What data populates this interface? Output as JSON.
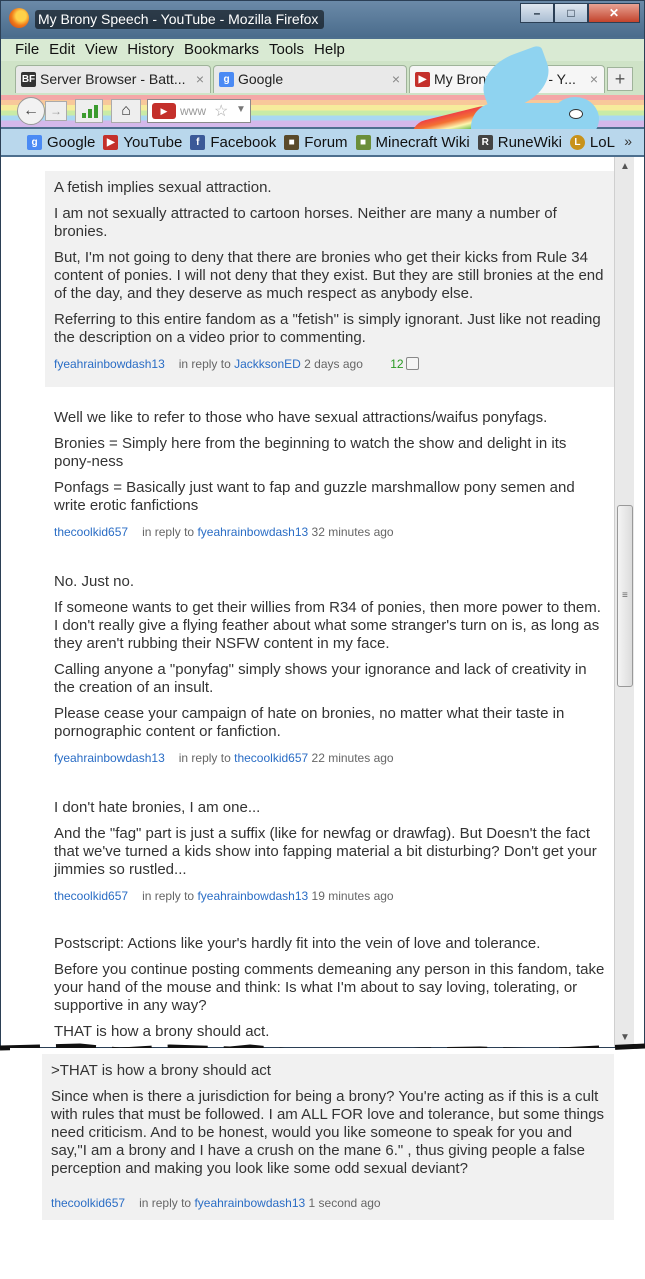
{
  "window": {
    "title": "My Brony Speech - YouTube - Mozilla Firefox",
    "controls": [
      "–",
      "□",
      "✕"
    ]
  },
  "menu": [
    "File",
    "Edit",
    "View",
    "History",
    "Bookmarks",
    "Tools",
    "Help"
  ],
  "tabs": [
    {
      "label": "Server Browser - Batt...",
      "icon": "bf-icon",
      "close": "×"
    },
    {
      "label": "Google",
      "icon": "google-icon",
      "close": "×"
    },
    {
      "label": "My Brony Speech - Y...",
      "icon": "youtube-icon",
      "close": "×"
    }
  ],
  "new_tab": "+",
  "nav": {
    "url_text": "www",
    "back": "←",
    "forward": "→"
  },
  "bookmarks": [
    {
      "label": "Google",
      "icon": "google-icon",
      "color": "#4a8af4"
    },
    {
      "label": "YouTube",
      "icon": "youtube-icon",
      "color": "#c4302b"
    },
    {
      "label": "Facebook",
      "icon": "facebook-icon",
      "color": "#3b5998"
    },
    {
      "label": "Forum",
      "icon": "forum-icon",
      "color": "#5a4a2a"
    },
    {
      "label": "Minecraft Wiki",
      "icon": "minecraft-icon",
      "color": "#6b8e3a"
    },
    {
      "label": "RuneWiki",
      "icon": "runewiki-icon",
      "color": "#444444"
    },
    {
      "label": "LoL",
      "icon": "lol-icon",
      "color": "#c8921a"
    }
  ],
  "bookmarks_more": "»",
  "comments": [
    {
      "paragraphs": [
        "A fetish implies sexual attraction.",
        "I am not sexually attracted to cartoon horses. Neither are many a number of bronies.",
        "But, I'm not going to deny that there are bronies who get their kicks from Rule 34 content of ponies. I will not deny that they exist. But they are still bronies at the end of the day, and they deserve as much respect as anybody else.",
        "Referring to this entire fandom as a \"fetish\" is simply ignorant. Just like not reading the description on a video prior to commenting."
      ],
      "user": "fyeahrainbowdash13",
      "in_reply_to": "in reply to",
      "reply_user": "JackksonED",
      "time": "2 days ago",
      "likes": "12"
    },
    {
      "paragraphs": [
        "Well we like to refer to those who have sexual attractions/waifus ponyfags.",
        "Bronies = Simply here from the beginning to watch the show and delight in its pony-ness",
        "Ponfags = Basically just want to fap and guzzle marshmallow pony semen and write erotic fanfictions"
      ],
      "user": "thecoolkid657",
      "in_reply_to": "in reply to",
      "reply_user": "fyeahrainbowdash13",
      "time": "32 minutes ago"
    },
    {
      "paragraphs": [
        "No. Just no.",
        "If someone wants to get their willies from R34 of ponies, then more power to them. I don't really give a flying feather about what some stranger's turn on is, as long as they aren't rubbing their NSFW content in my face.",
        "Calling anyone a \"ponyfag\" simply shows your ignorance and lack of creativity in the creation of an insult.",
        "Please cease your campaign of hate on bronies, no matter what their taste in pornographic content or fanfiction."
      ],
      "user": "fyeahrainbowdash13",
      "in_reply_to": "in reply to",
      "reply_user": "thecoolkid657",
      "time": "22 minutes ago"
    },
    {
      "paragraphs": [
        "I don't hate bronies, I am one...",
        "And the \"fag\" part is just a suffix (like for newfag or drawfag). But Doesn't the fact that we've turned a kids show into fapping material a bit disturbing? Don't get your jimmies so rustled..."
      ],
      "user": "thecoolkid657",
      "in_reply_to": "in reply to",
      "reply_user": "fyeahrainbowdash13",
      "time": "19 minutes ago"
    },
    {
      "paragraphs": [
        "Postscript: Actions like your's hardly fit into the vein of love and tolerance.",
        "Before you continue posting comments demeaning any person in this fandom, take your hand of the mouse and think: Is what I'm about to say loving, tolerating, or supportive in any way?",
        "THAT is how a brony should act."
      ]
    }
  ],
  "pasted_comment": {
    "paragraphs": [
      ">THAT is how a brony should act",
      "Since when is there a jurisdiction for being a brony? You're acting as if this is a cult with rules that must be followed. I am ALL FOR love and tolerance, but some things need criticism. And to be honest, would you like someone to speak for you and say,\"I am a brony and I have a crush on the mane 6.\" , thus giving people a false perception and making you look like some odd sexual deviant?"
    ],
    "user": "thecoolkid657",
    "in_reply_to": "in reply to",
    "reply_user": "fyeahrainbowdash13",
    "time": "1 second ago"
  },
  "scrollbar": {
    "up": "▲",
    "down": "▼",
    "grip": "≡"
  }
}
